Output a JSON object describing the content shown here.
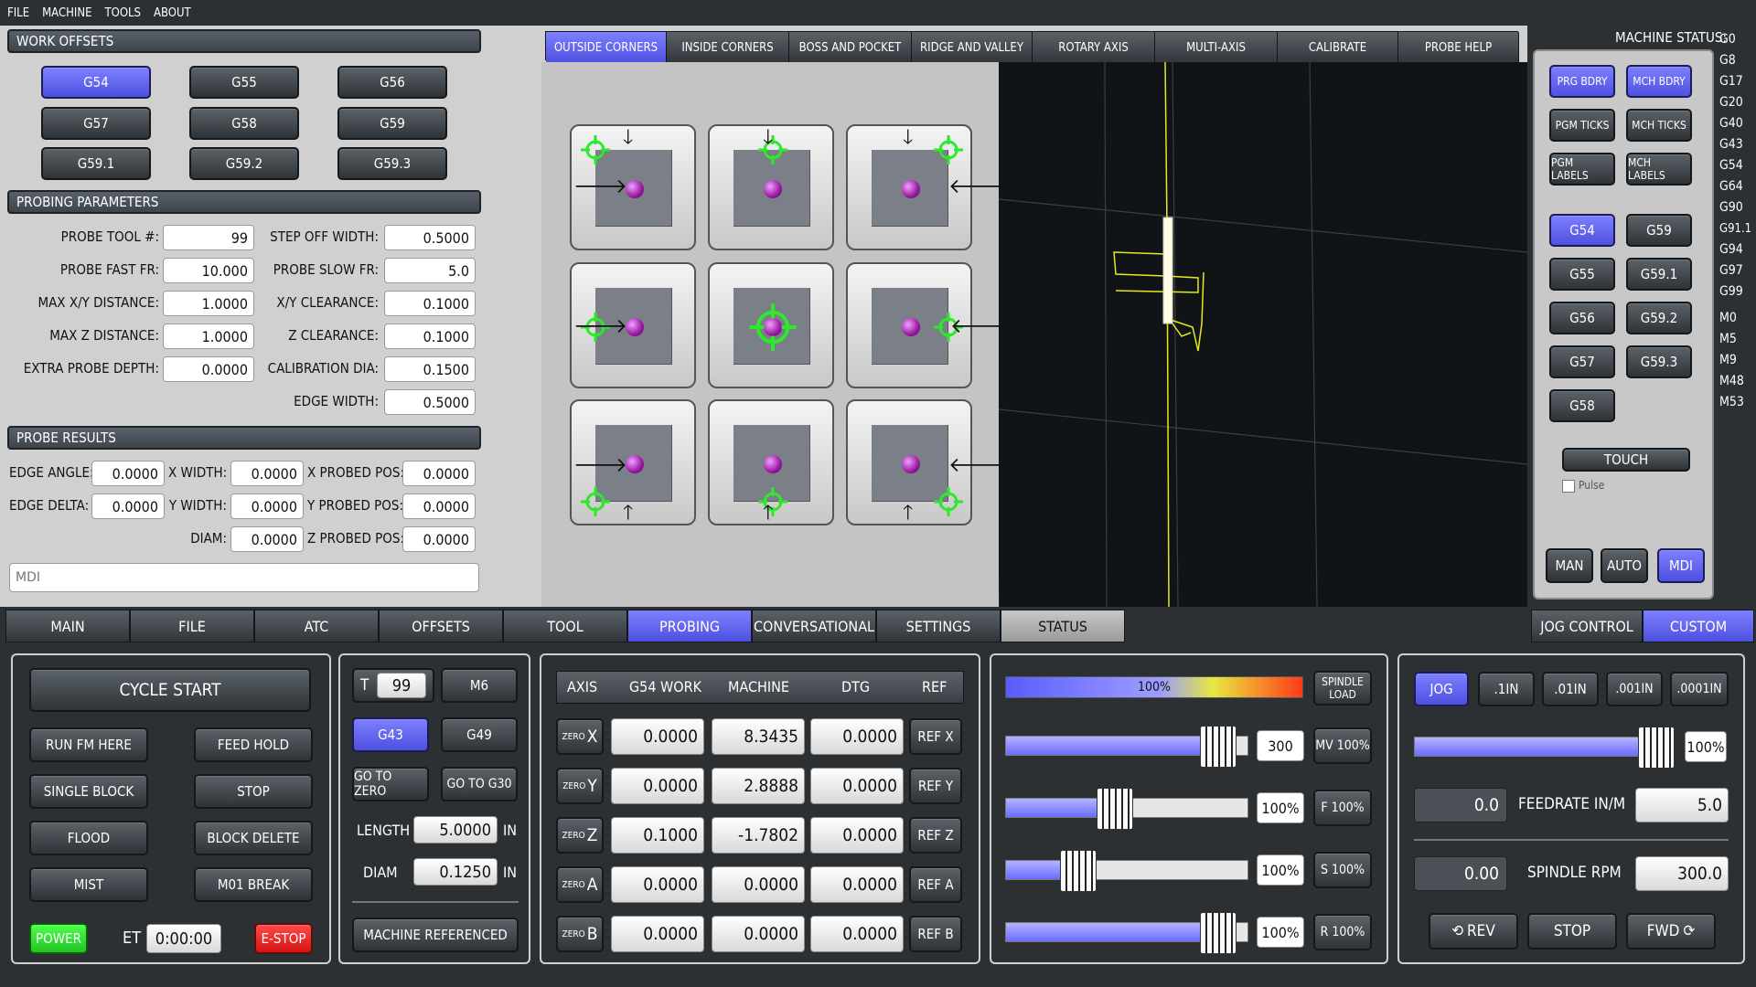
{
  "menu": [
    "FILE",
    "MACHINE",
    "TOOLS",
    "ABOUT"
  ],
  "work_offsets": {
    "title": "WORK OFFSETS",
    "buttons": [
      "G54",
      "G55",
      "G56",
      "G57",
      "G58",
      "G59",
      "G59.1",
      "G59.2",
      "G59.3"
    ],
    "active": "G54"
  },
  "probing_params": {
    "title": "PROBING PARAMETERS",
    "left": [
      {
        "label": "PROBE TOOL #:",
        "value": "99"
      },
      {
        "label": "PROBE FAST FR:",
        "value": "10.000"
      },
      {
        "label": "MAX X/Y DISTANCE:",
        "value": "1.0000"
      },
      {
        "label": "MAX Z DISTANCE:",
        "value": "1.0000"
      },
      {
        "label": "EXTRA PROBE DEPTH:",
        "value": "0.0000"
      }
    ],
    "right": [
      {
        "label": "STEP OFF WIDTH:",
        "value": "0.5000"
      },
      {
        "label": "PROBE SLOW FR:",
        "value": "5.0"
      },
      {
        "label": "X/Y CLEARANCE:",
        "value": "0.1000"
      },
      {
        "label": "Z CLEARANCE:",
        "value": "0.1000"
      },
      {
        "label": "CALIBRATION DIA:",
        "value": "0.1500"
      },
      {
        "label": "EDGE WIDTH:",
        "value": "0.5000"
      }
    ]
  },
  "probe_results": {
    "title": "PROBE RESULTS",
    "rows": [
      [
        {
          "label": "EDGE ANGLE:",
          "value": "0.0000"
        },
        {
          "label": "X WIDTH:",
          "value": "0.0000"
        },
        {
          "label": "X PROBED POS:",
          "value": "0.0000"
        }
      ],
      [
        {
          "label": "EDGE DELTA:",
          "value": "0.0000"
        },
        {
          "label": "Y WIDTH:",
          "value": "0.0000"
        },
        {
          "label": "Y PROBED POS:",
          "value": "0.0000"
        }
      ],
      [
        {
          "label": "",
          "value": ""
        },
        {
          "label": "DIAM:",
          "value": "0.0000"
        },
        {
          "label": "Z PROBED POS:",
          "value": "0.0000"
        }
      ]
    ]
  },
  "mdi": {
    "placeholder": "MDI"
  },
  "probe_tabs": [
    "OUTSIDE CORNERS",
    "INSIDE CORNERS",
    "BOSS AND POCKET",
    "RIDGE AND VALLEY",
    "ROTARY AXIS",
    "MULTI-AXIS",
    "CALIBRATE",
    "PROBE HELP"
  ],
  "probe_tab_active": "OUTSIDE CORNERS",
  "machine_status": {
    "title": "MACHINE STATUS:",
    "codes": [
      "G0",
      "G8",
      "G17",
      "G20",
      "G40",
      "G43",
      "G54",
      "G64",
      "G90",
      "G91.1",
      "G94",
      "G97",
      "G99",
      "M0",
      "M5",
      "M9",
      "M48",
      "M53"
    ]
  },
  "view_buttons": [
    "PRG BDRY",
    "MCH BDRY",
    "PGM TICKS",
    "MCH TICKS",
    "PGM LABELS",
    "MCH LABELS"
  ],
  "view_offset_buttons": [
    "G54",
    "G59",
    "G55",
    "G59.1",
    "G56",
    "G59.2",
    "G57",
    "G59.3",
    "G58"
  ],
  "touch": {
    "label": "TOUCH",
    "pulse": "Pulse"
  },
  "modes": [
    "MAN",
    "AUTO",
    "MDI"
  ],
  "mode_active": "MDI",
  "main_tabs": [
    "MAIN",
    "FILE",
    "ATC",
    "OFFSETS",
    "TOOL",
    "PROBING",
    "CONVERSATIONAL",
    "SETTINGS",
    "STATUS"
  ],
  "main_tab_active": "PROBING",
  "right_tabs": [
    "JOG CONTROL",
    "CUSTOM"
  ],
  "right_tab_active": "CUSTOM",
  "cycle": {
    "cycle_start": "CYCLE START",
    "run_from_here": "RUN FM HERE",
    "feed_hold": "FEED HOLD",
    "single_block": "SINGLE BLOCK",
    "stop": "STOP",
    "flood": "FLOOD",
    "block_delete": "BLOCK DELETE",
    "mist": "MIST",
    "m01_break": "M01 BREAK",
    "power": "POWER",
    "et_label": "ET",
    "et_value": "0:00:00",
    "estop": "E-STOP"
  },
  "tool": {
    "t_label": "T",
    "t_value": "99",
    "m6": "M6",
    "g43": "G43",
    "g49": "G49",
    "go_zero": "GO TO ZERO",
    "go_g30": "GO TO G30",
    "length_label": "LENGTH",
    "length_value": "5.0000",
    "length_unit": "IN",
    "diam_label": "DIAM",
    "diam_value": "0.1250",
    "diam_unit": "IN",
    "machine_ref": "MACHINE REFERENCED"
  },
  "dro": {
    "headers": [
      "AXIS",
      "G54 WORK",
      "MACHINE",
      "DTG",
      "REF"
    ],
    "rows": [
      {
        "axis": "X",
        "zero": "ZERO",
        "work": "0.0000",
        "machine": "8.3435",
        "dtg": "0.0000",
        "ref": "REF X"
      },
      {
        "axis": "Y",
        "zero": "ZERO",
        "work": "0.0000",
        "machine": "2.8888",
        "dtg": "0.0000",
        "ref": "REF Y"
      },
      {
        "axis": "Z",
        "zero": "ZERO",
        "work": "0.1000",
        "machine": "-1.7802",
        "dtg": "0.0000",
        "ref": "REF Z"
      },
      {
        "axis": "A",
        "zero": "ZERO",
        "work": "0.0000",
        "machine": "0.0000",
        "dtg": "0.0000",
        "ref": "REF A"
      },
      {
        "axis": "B",
        "zero": "ZERO",
        "work": "0.0000",
        "machine": "0.0000",
        "dtg": "0.0000",
        "ref": "REF B"
      }
    ]
  },
  "overrides": {
    "spindle_load": {
      "value_pct": 100,
      "text": "100%",
      "label1": "SPINDLE",
      "label2": "LOAD"
    },
    "max_vel": {
      "fill_pct": 88,
      "value": "300",
      "button": "MV 100%"
    },
    "feed": {
      "fill_pct": 45,
      "value": "100%",
      "button": "F 100%"
    },
    "spindle": {
      "fill_pct": 30,
      "value": "100%",
      "button": "S 100%"
    },
    "rapid": {
      "fill_pct": 88,
      "value": "100%",
      "button": "R 100%"
    }
  },
  "jog": {
    "buttons": [
      "JOG",
      ".1IN",
      ".01IN",
      ".001IN",
      ".0001IN"
    ],
    "active": "JOG",
    "rate_fill_pct": 95,
    "rate_value": "100%",
    "feed_actual": "0.0",
    "feed_label": "FEEDRATE IN/M",
    "feed_set": "5.0",
    "rpm_actual": "0.00",
    "rpm_label": "SPINDLE RPM",
    "rpm_set": "300.0",
    "rev": "REV",
    "stop": "STOP",
    "fwd": "FWD"
  }
}
